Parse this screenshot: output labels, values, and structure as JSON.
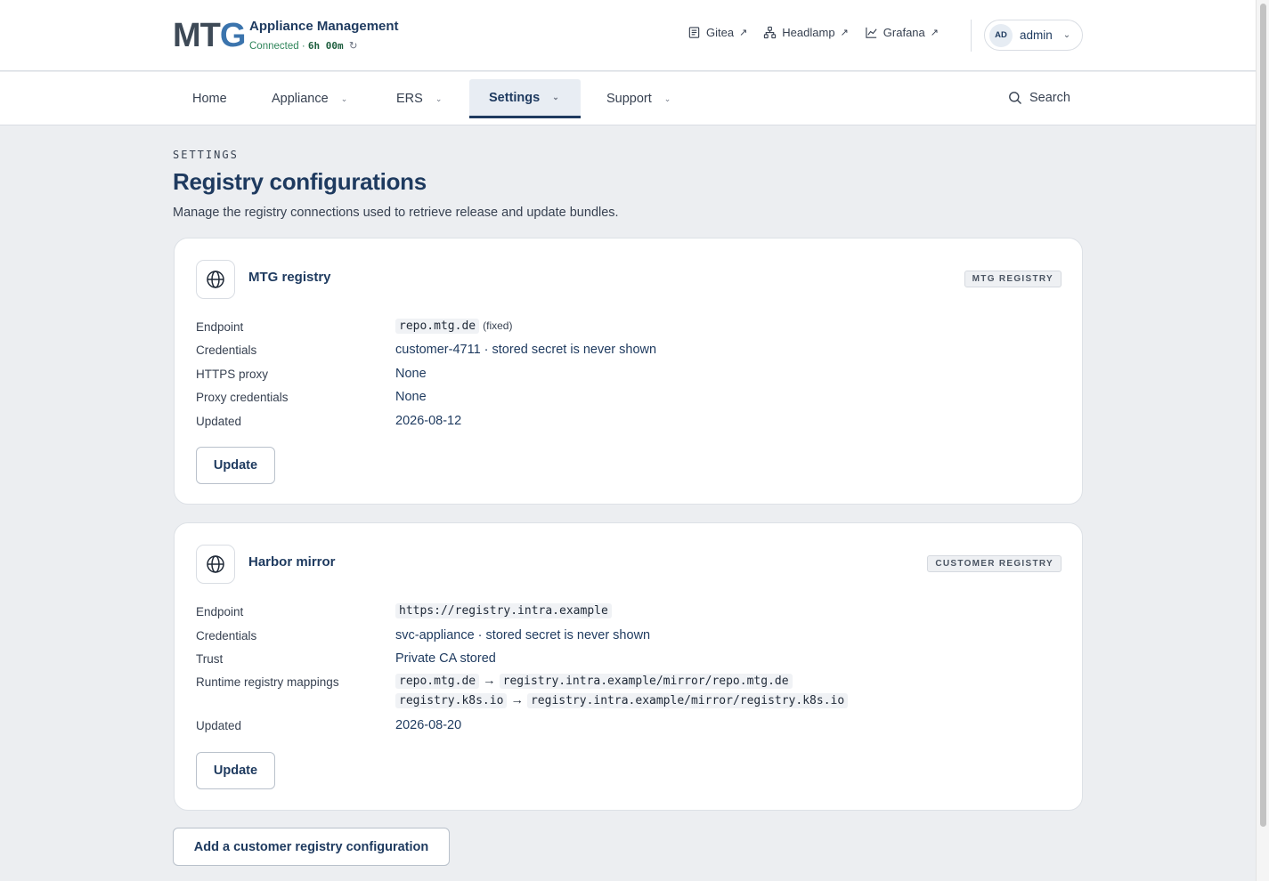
{
  "header": {
    "logo_prefix": "MT",
    "logo_suffix": "G",
    "app_title": "Appliance Management",
    "status_label": "Connected ·",
    "uptime": "6h 00m",
    "refresh_glyph": "↻",
    "links": [
      {
        "label": "Gitea",
        "icon": "document-icon"
      },
      {
        "label": "Headlamp",
        "icon": "cluster-icon"
      },
      {
        "label": "Grafana",
        "icon": "chart-icon"
      }
    ],
    "external_glyph": "↗",
    "user": {
      "initials": "AD",
      "name": "admin"
    }
  },
  "nav": {
    "items": [
      {
        "label": "Home",
        "has_menu": false
      },
      {
        "label": "Appliance",
        "has_menu": true
      },
      {
        "label": "ERS",
        "has_menu": true
      },
      {
        "label": "Settings",
        "has_menu": true,
        "active": true
      },
      {
        "label": "Support",
        "has_menu": true
      }
    ],
    "search_label": "Search",
    "chevron_glyph": "⌄"
  },
  "page": {
    "eyebrow": "SETTINGS",
    "title": "Registry configurations",
    "subtitle": "Manage the registry connections used to retrieve release and update bundles."
  },
  "registries": [
    {
      "name": "MTG registry",
      "badge": "MTG REGISTRY",
      "endpoint_label": "Endpoint",
      "endpoint": "repo.mtg.de",
      "endpoint_note": "(fixed)",
      "credentials_label": "Credentials",
      "credentials": "customer-4711 · stored secret is never shown",
      "proxy_label": "HTTPS proxy",
      "proxy": "None",
      "proxy_credentials_label": "Proxy credentials",
      "proxy_credentials": "None",
      "updated_label": "Updated",
      "updated": "2026-08-12",
      "button": "Update"
    },
    {
      "name": "Harbor mirror",
      "badge": "CUSTOMER REGISTRY",
      "endpoint_label": "Endpoint",
      "endpoint": "https://registry.intra.example",
      "credentials_label": "Credentials",
      "credentials": "svc-appliance · stored secret is never shown",
      "trust_label": "Trust",
      "trust": "Private CA stored",
      "mappings_label": "Runtime registry mappings",
      "mappings": [
        {
          "from": "repo.mtg.de",
          "arrow": "→",
          "to": "registry.intra.example/mirror/repo.mtg.de"
        },
        {
          "from": "registry.k8s.io",
          "arrow": "→",
          "to": "registry.intra.example/mirror/registry.k8s.io"
        }
      ],
      "updated_label": "Updated",
      "updated": "2026-08-20",
      "button": "Update"
    }
  ],
  "add_button": "Add a customer registry configuration"
}
